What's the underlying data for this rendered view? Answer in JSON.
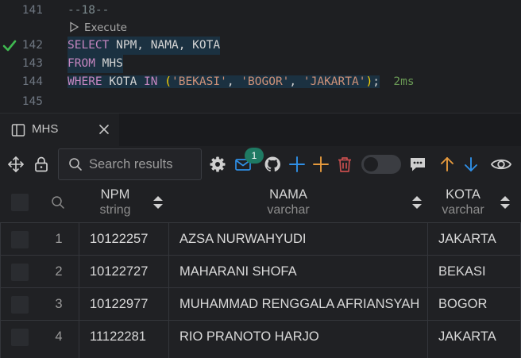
{
  "editor": {
    "lines": [
      {
        "num": "141",
        "text": "--18--"
      },
      {
        "num": "142"
      },
      {
        "num": "143"
      },
      {
        "num": "144"
      },
      {
        "num": "145"
      }
    ],
    "codelens": "Execute",
    "sql": {
      "select_kw": "SELECT",
      "select_cols": " NPM, NAMA, KOTA",
      "from_kw": "FROM",
      "from_table": " MHS",
      "where_kw": "WHERE",
      "where_col": " KOTA ",
      "in_kw": "IN",
      "space": " ",
      "open_paren": "(",
      "v1": "'BEKASI'",
      "comma1": ", ",
      "v2": "'BOGOR'",
      "comma2": ", ",
      "v3": "'JAKARTA'",
      "close_paren": ")",
      "semicolon": ";",
      "duration": "2ms"
    },
    "status_color": "#3fb950"
  },
  "tab": {
    "label": "MHS"
  },
  "toolbar": {
    "search_placeholder": "Search results",
    "notification_count": "1",
    "accent": "#2f8fe6",
    "add_color": "#e69a3d",
    "delete_color": "#c74e4e"
  },
  "table": {
    "columns": [
      {
        "name": "NPM",
        "type": "string"
      },
      {
        "name": "NAMA",
        "type": "varchar"
      },
      {
        "name": "KOTA",
        "type": "varchar"
      }
    ],
    "rows": [
      {
        "n": "1",
        "npm": "10122257",
        "nama": "AZSA NURWAHYUDI",
        "kota": "JAKARTA"
      },
      {
        "n": "2",
        "npm": "10122727",
        "nama": "MAHARANI SHOFA",
        "kota": "BEKASI"
      },
      {
        "n": "3",
        "npm": "10122977",
        "nama": "MUHAMMAD RENGGALA AFRIANSYAH",
        "kota": "BOGOR"
      },
      {
        "n": "4",
        "npm": "11122281",
        "nama": "RIO PRANOTO HARJO",
        "kota": "JAKARTA"
      }
    ]
  }
}
